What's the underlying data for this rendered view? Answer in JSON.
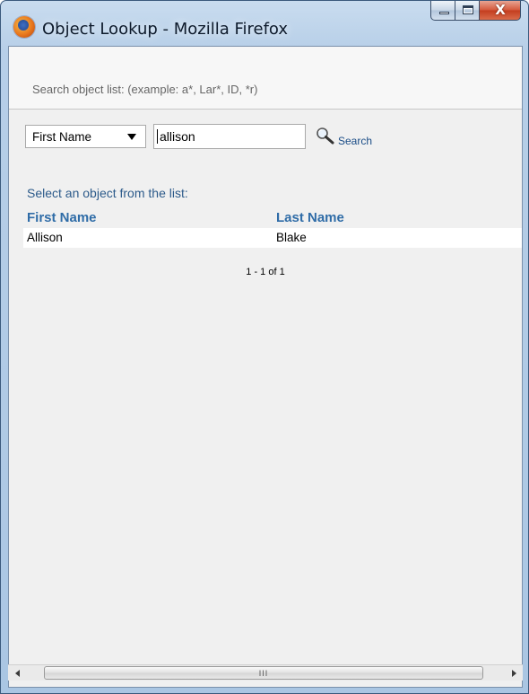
{
  "window": {
    "title": "Object Lookup - Mozilla Firefox",
    "controls": {
      "minimize": "minimize",
      "maximize": "maximize",
      "close": "X"
    }
  },
  "search": {
    "hint": "Search object list: (example: a*, Lar*, ID, *r)",
    "field_selected": "First Name",
    "query": "allison",
    "button_label": "Search"
  },
  "results": {
    "prompt": "Select an object from the list:",
    "columns": [
      "First Name",
      "Last Name"
    ],
    "rows": [
      {
        "first_name": "Allison",
        "last_name": "Blake"
      }
    ],
    "pager": "1 - 1 of 1"
  },
  "scrollbar": {
    "grip": "III"
  }
}
